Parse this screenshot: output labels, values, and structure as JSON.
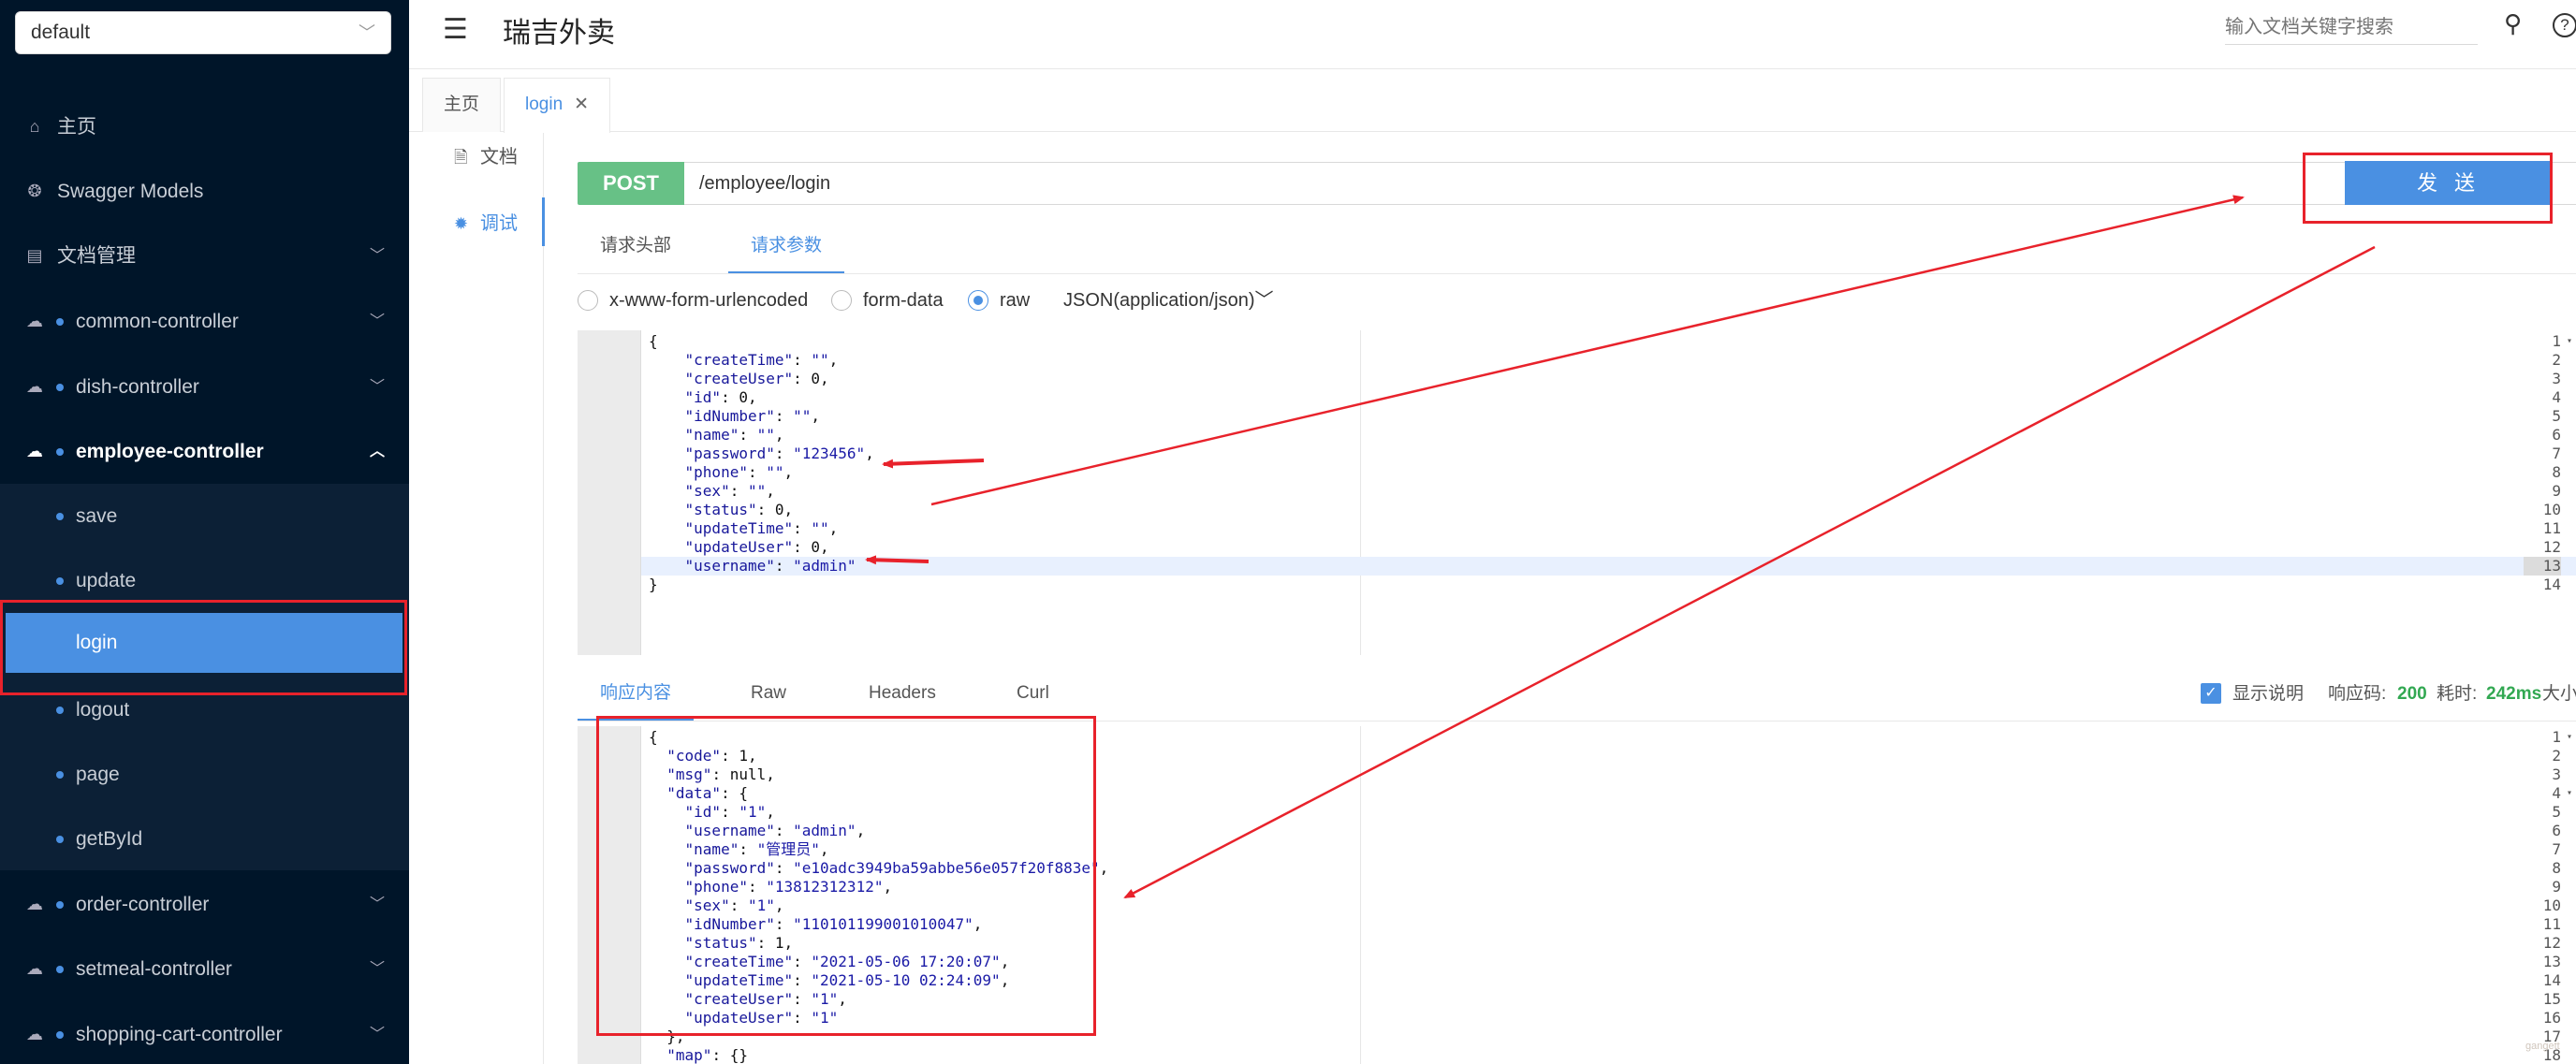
{
  "group_select": {
    "value": "default"
  },
  "sidebar": {
    "items": [
      {
        "label": "主页",
        "icon": "home-icon"
      },
      {
        "label": "Swagger Models",
        "icon": "model-icon"
      },
      {
        "label": "文档管理",
        "icon": "doc-manage-icon"
      },
      {
        "label": "common-controller",
        "icon": "cloud-icon"
      },
      {
        "label": "dish-controller",
        "icon": "cloud-icon"
      },
      {
        "label": "employee-controller",
        "icon": "cloud-icon"
      },
      {
        "label": "order-controller",
        "icon": "cloud-icon"
      },
      {
        "label": "setmeal-controller",
        "icon": "cloud-icon"
      },
      {
        "label": "shopping-cart-controller",
        "icon": "cloud-icon"
      }
    ],
    "sub_items": [
      "save",
      "update",
      "login",
      "logout",
      "page",
      "getById"
    ]
  },
  "header": {
    "title": "瑞吉外卖",
    "search_placeholder": "输入文档关键字搜索",
    "help": "?"
  },
  "tabs": [
    {
      "label": "主页"
    },
    {
      "label": "login"
    }
  ],
  "side_tabs": [
    {
      "label": "文档"
    },
    {
      "label": "调试"
    }
  ],
  "request": {
    "method": "POST",
    "url": "/employee/login",
    "send_label": "发 送",
    "tabs": [
      "请求头部",
      "请求参数"
    ],
    "body_types": [
      "x-www-form-urlencoded",
      "form-data",
      "raw"
    ],
    "content_type": "JSON(application/json)",
    "body_lines": [
      "{",
      "    \"createTime\": \"\",",
      "    \"createUser\": 0,",
      "    \"id\": 0,",
      "    \"idNumber\": \"\",",
      "    \"name\": \"\",",
      "    \"password\": \"123456\",",
      "    \"phone\": \"\",",
      "    \"sex\": \"\",",
      "    \"status\": 0,",
      "    \"updateTime\": \"\",",
      "    \"updateUser\": 0,",
      "    \"username\": \"admin\"",
      "}"
    ]
  },
  "response": {
    "tabs": [
      "响应内容",
      "Raw",
      "Headers",
      "Curl"
    ],
    "show_desc_label": "显示说明",
    "status_label": "响应码:",
    "status_value": "200",
    "time_label": "耗时:",
    "time_value": "242ms",
    "size_label": "大小",
    "body_lines": [
      "{",
      "  \"code\": 1,",
      "  \"msg\": null,",
      "  \"data\": {",
      "    \"id\": \"1\",",
      "    \"username\": \"admin\",",
      "    \"name\": \"管理员\",",
      "    \"password\": \"e10adc3949ba59abbe56e057f20f883e\",",
      "    \"phone\": \"13812312312\",",
      "    \"sex\": \"1\",",
      "    \"idNumber\": \"110101199001010047\",",
      "    \"status\": 1,",
      "    \"createTime\": \"2021-05-06 17:20:07\",",
      "    \"updateTime\": \"2021-05-10 02:24:09\",",
      "    \"createUser\": \"1\",",
      "    \"updateUser\": \"1\"",
      "  },",
      "  \"map\": {}"
    ]
  },
  "watermark": "gangett",
  "colors": {
    "sidebar_bg": "#001529",
    "accent": "#4a90e2",
    "post_green": "#67c186",
    "annotation_red": "#e8222b"
  }
}
